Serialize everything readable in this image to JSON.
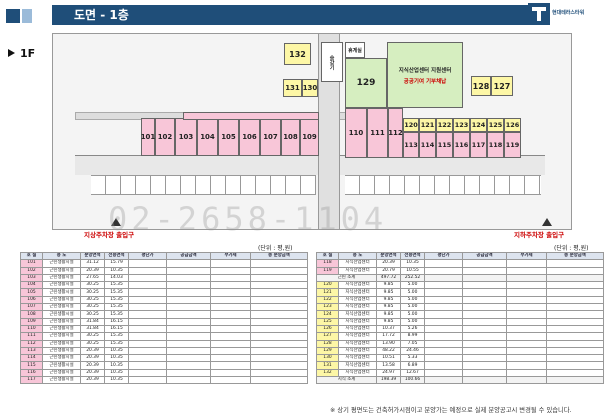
{
  "header": {
    "title": "도면 - 1층",
    "company": "현대테라스타워"
  },
  "plan": {
    "floor": "1F",
    "rooms_left": [
      "101",
      "102",
      "103",
      "104",
      "105",
      "106",
      "107",
      "108",
      "109"
    ],
    "rooms_right_row1": [
      "120",
      "121",
      "122",
      "123",
      "124",
      "125",
      "126"
    ],
    "rooms_right_row2": [
      "113",
      "114",
      "115",
      "116",
      "117",
      "118",
      "119"
    ],
    "rooms_right_big": [
      "110",
      "111",
      "112"
    ],
    "room_132": "132",
    "room_131": "131",
    "room_130": "130",
    "room_129": "129",
    "room_128": "128",
    "room_127": "127",
    "rest": "휴게실",
    "stair": "승강기",
    "center_title": "지식산업센터 지원센터",
    "center_sub": "공공기여 기부채납",
    "entrance_left": "지상주차장 출입구",
    "entrance_right": "지하주차장 출입구",
    "watermark": "02-2658-1104"
  },
  "units_label": "(단위 : 평,원)",
  "table_headers": [
    "호 실",
    "용 도",
    "분양면적",
    "전용면적",
    "평단가",
    "공급금액",
    "부가세",
    "총 분양금액"
  ],
  "left_rows": [
    [
      "101",
      "근린생활시설",
      "31.12",
      "15.79"
    ],
    [
      "102",
      "근린생활시설",
      "20.39",
      "10.35"
    ],
    [
      "103",
      "근린생활시설",
      "27.65",
      "14.03"
    ],
    [
      "104",
      "근린생활시설",
      "30.25",
      "15.35"
    ],
    [
      "105",
      "근린생활시설",
      "30.25",
      "15.35"
    ],
    [
      "106",
      "근린생활시설",
      "30.25",
      "15.35"
    ],
    [
      "107",
      "근린생활시설",
      "30.25",
      "15.35"
    ],
    [
      "108",
      "근린생활시설",
      "30.25",
      "15.35"
    ],
    [
      "109",
      "근린생활시설",
      "31.84",
      "16.15"
    ],
    [
      "110",
      "근린생활시설",
      "31.84",
      "16.15"
    ],
    [
      "111",
      "근린생활시설",
      "30.25",
      "15.35"
    ],
    [
      "112",
      "근린생활시설",
      "30.25",
      "15.35"
    ],
    [
      "113",
      "근린생활시설",
      "20.39",
      "10.35"
    ],
    [
      "114",
      "근린생활시설",
      "20.39",
      "10.35"
    ],
    [
      "115",
      "근린생활시설",
      "20.39",
      "10.35"
    ],
    [
      "116",
      "근린생활시설",
      "20.39",
      "10.35"
    ],
    [
      "117",
      "근린생활시설",
      "20.39",
      "10.35"
    ]
  ],
  "right_rows": [
    [
      "118",
      "지식산업센터",
      "20.39",
      "10.35"
    ],
    [
      "119",
      "지식산업센터",
      "20.79",
      "10.55"
    ],
    [
      "근린 소계",
      "",
      "497.72",
      "252.52"
    ],
    [
      "120",
      "지식산업센터",
      "9.85",
      "5.00"
    ],
    [
      "121",
      "지식산업센터",
      "9.85",
      "5.00"
    ],
    [
      "122",
      "지식산업센터",
      "9.85",
      "5.00"
    ],
    [
      "123",
      "지식산업센터",
      "9.85",
      "5.00"
    ],
    [
      "124",
      "지식산업센터",
      "9.85",
      "5.00"
    ],
    [
      "125",
      "지식산업센터",
      "9.85",
      "5.00"
    ],
    [
      "126",
      "지식산업센터",
      "10.37",
      "5.26"
    ],
    [
      "127",
      "지식산업센터",
      "17.72",
      "8.99"
    ],
    [
      "128",
      "지식산업센터",
      "13.90",
      "7.05"
    ],
    [
      "129",
      "지식산업센터",
      "48.22",
      "24.46"
    ],
    [
      "130",
      "지식산업센터",
      "10.51",
      "5.33"
    ],
    [
      "131",
      "지식산업센터",
      "13.58",
      "6.89"
    ],
    [
      "132",
      "지식산업센터",
      "24.97",
      "12.67"
    ],
    [
      "지식 소계",
      "",
      "198.39",
      "100.66"
    ]
  ],
  "note": "※ 상기 평면도는 건축허가시점이고 분양가는 예정으로 실제 분양공고시  변경될 수 있습니다."
}
